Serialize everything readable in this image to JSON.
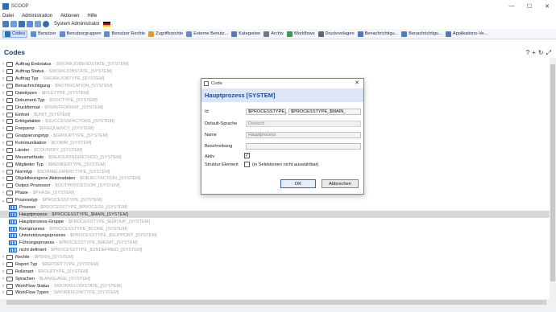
{
  "window": {
    "title": "SCOOP",
    "controls": [
      "—",
      "☐",
      "✕"
    ]
  },
  "menu": [
    "Datei",
    "Administration",
    "Aktionen",
    "Hilfe"
  ],
  "quickbar": {
    "user": "System Administrator"
  },
  "toolbar": [
    {
      "label": "Codes",
      "color": "#2f6db5",
      "active": true
    },
    {
      "label": "Benutzer",
      "color": "#5a8ed6"
    },
    {
      "label": "Benutzergruppen",
      "color": "#5a8ed6"
    },
    {
      "label": "Benutzer Rechte",
      "color": "#5a8ed6"
    },
    {
      "label": "Zugriffsrechte",
      "color": "#d8a02a"
    },
    {
      "label": "Externe Benutz...",
      "color": "#5a8ed6"
    },
    {
      "label": "Kategorien",
      "color": "#4a7bc4"
    },
    {
      "label": "Archiv",
      "color": "#6a7a8c"
    },
    {
      "label": "Workflows",
      "color": "#3a9a5a"
    },
    {
      "label": "Druckvorlagen",
      "color": "#5a6a7c"
    },
    {
      "label": "Benachrichtigu...",
      "color": "#4a7bc4"
    },
    {
      "label": "Benachrichtigu...",
      "color": "#4a7bc4"
    },
    {
      "label": "Applikations-Ve...",
      "color": "#4a7bc4"
    }
  ],
  "section": {
    "title": "Codes",
    "tools": [
      "?",
      "+",
      "↻",
      "⤢"
    ]
  },
  "tree": [
    {
      "name": "Auftrag Endstatus",
      "code": "SWORKJOBENDSTATE_[SYSTEM]",
      "type": "folder"
    },
    {
      "name": "Auftrag Status",
      "code": "SWORKJOBSTATE_[SYSTEM]",
      "type": "folder"
    },
    {
      "name": "Auftrag Typ",
      "code": "SWORKJOBTYPE_[SYSTEM]",
      "type": "folder"
    },
    {
      "name": "Benachrichtigung",
      "code": "$NOTIFICATION_[SYSTEM]",
      "type": "folder"
    },
    {
      "name": "Dateitypen",
      "code": "$FILETYPE_[SYSTEM]",
      "type": "folder"
    },
    {
      "name": "Dokument-Typ",
      "code": "$DOCTYPE_[SYSTEM]",
      "type": "folder"
    },
    {
      "name": "Druckformat",
      "code": "$PRINTFORMAT_[SYSTEM]",
      "type": "folder"
    },
    {
      "name": "Einheit",
      "code": "$UNIT_[SYSTEM]",
      "type": "folder"
    },
    {
      "name": "Erfolgsfaktor",
      "code": "$SUCCESSFACTORS_[SYSTEM]",
      "type": "folder"
    },
    {
      "name": "Frequenz",
      "code": "$FREQUENCY_[SYSTEM]",
      "type": "folder"
    },
    {
      "name": "Gruppierungstyp",
      "code": "$GROUPTYPE_[SYSTEM]",
      "type": "folder"
    },
    {
      "name": "Kommunikation",
      "code": "$COMM_[SYSTEM]",
      "type": "folder"
    },
    {
      "name": "Länder",
      "code": "$COUNTRY_[SYSTEM]",
      "type": "folder"
    },
    {
      "name": "Messmethode",
      "code": "$MEASURINGMETHOD_[SYSTEM]",
      "type": "folder"
    },
    {
      "name": "Mitglieder Typ",
      "code": "$MEMBERTYPE_[SYSTEM]",
      "type": "folder"
    },
    {
      "name": "Normtyp",
      "code": "$NORMELEMENTTYPE_[SYSTEM]",
      "type": "folder"
    },
    {
      "name": "Objektbezogene Aktionsdaten",
      "code": "$OBJECTACTION_[SYSTEM]",
      "type": "folder"
    },
    {
      "name": "Output Prozessor",
      "code": "$OUTPROCESSOR_[SYSTEM]",
      "type": "folder"
    },
    {
      "name": "Phase",
      "code": "$PHASE_[SYSTEM]",
      "type": "folder"
    },
    {
      "name": "Prozesstyp",
      "code": "$PROCESSTYPE_[SYSTEM]",
      "type": "folder",
      "expanded": true
    },
    {
      "name": "Prozess",
      "code": "$PROCESSTYPE_$PROCESS_[SYSTEM]",
      "type": "leaf"
    },
    {
      "name": "Hauptprozess",
      "code": "$PROCESSTYPE_$MAIN_[SYSTEM]",
      "type": "leaf",
      "selected": true
    },
    {
      "name": "Hauptprozess-Gruppe",
      "code": "$PROCESSTYPE_$GROUP_[SYSTEM]",
      "type": "leaf"
    },
    {
      "name": "Kernprozess",
      "code": "$PROCESSTYPE_$CORE_[SYSTEM]",
      "type": "leaf"
    },
    {
      "name": "Unterstützungsprozess",
      "code": "$PROCESSTYPE_$SUPPORT_[SYSTEM]",
      "type": "leaf"
    },
    {
      "name": "Führungsprozess",
      "code": "$PROCESSTYPE_$MGMT_[SYSTEM]",
      "type": "leaf"
    },
    {
      "name": "nicht definiert",
      "code": "$PROCESSTYPE_$UNDEFINED_[SYSTEM]",
      "type": "leaf"
    },
    {
      "name": "Rechte",
      "code": "$PERM_[SYSTEM]",
      "type": "folder"
    },
    {
      "name": "Report Typ",
      "code": "$REPORTTYPE_[SYSTEM]",
      "type": "folder"
    },
    {
      "name": "Rollenart",
      "code": "$ROLETYPE_[SYSTEM]",
      "type": "folder"
    },
    {
      "name": "Sprachen",
      "code": "$LANGUAGE_[SYSTEM]",
      "type": "folder"
    },
    {
      "name": "WorkFlow Status",
      "code": "SWORKFLOWSTATE_[SYSTEM]",
      "type": "folder"
    },
    {
      "name": "WorkFlow Typen",
      "code": "SWORKFLOWTYPE_[SYSTEM]",
      "type": "folder"
    }
  ],
  "dialog": {
    "title": "Code",
    "header": "Hauptprozess [SYSTEM]",
    "labels": {
      "id": "Id",
      "default_language": "Default-Sprache",
      "name": "Name",
      "description": "Beschreibung",
      "active": "Aktiv",
      "structure_element": "Struktur Element",
      "structure_hint": "(in Selektionen nicht auswählbar)"
    },
    "values": {
      "id_prefix": "$PROCESSTYPE_",
      "id_full": "$PROCESSTYPE_$MAIN_",
      "default_language": "Deutsch",
      "name": "Hauptprozess",
      "description": "",
      "active": true,
      "structure_element": false
    },
    "ok_label": "OK",
    "cancel_label": "Abbrechen"
  }
}
